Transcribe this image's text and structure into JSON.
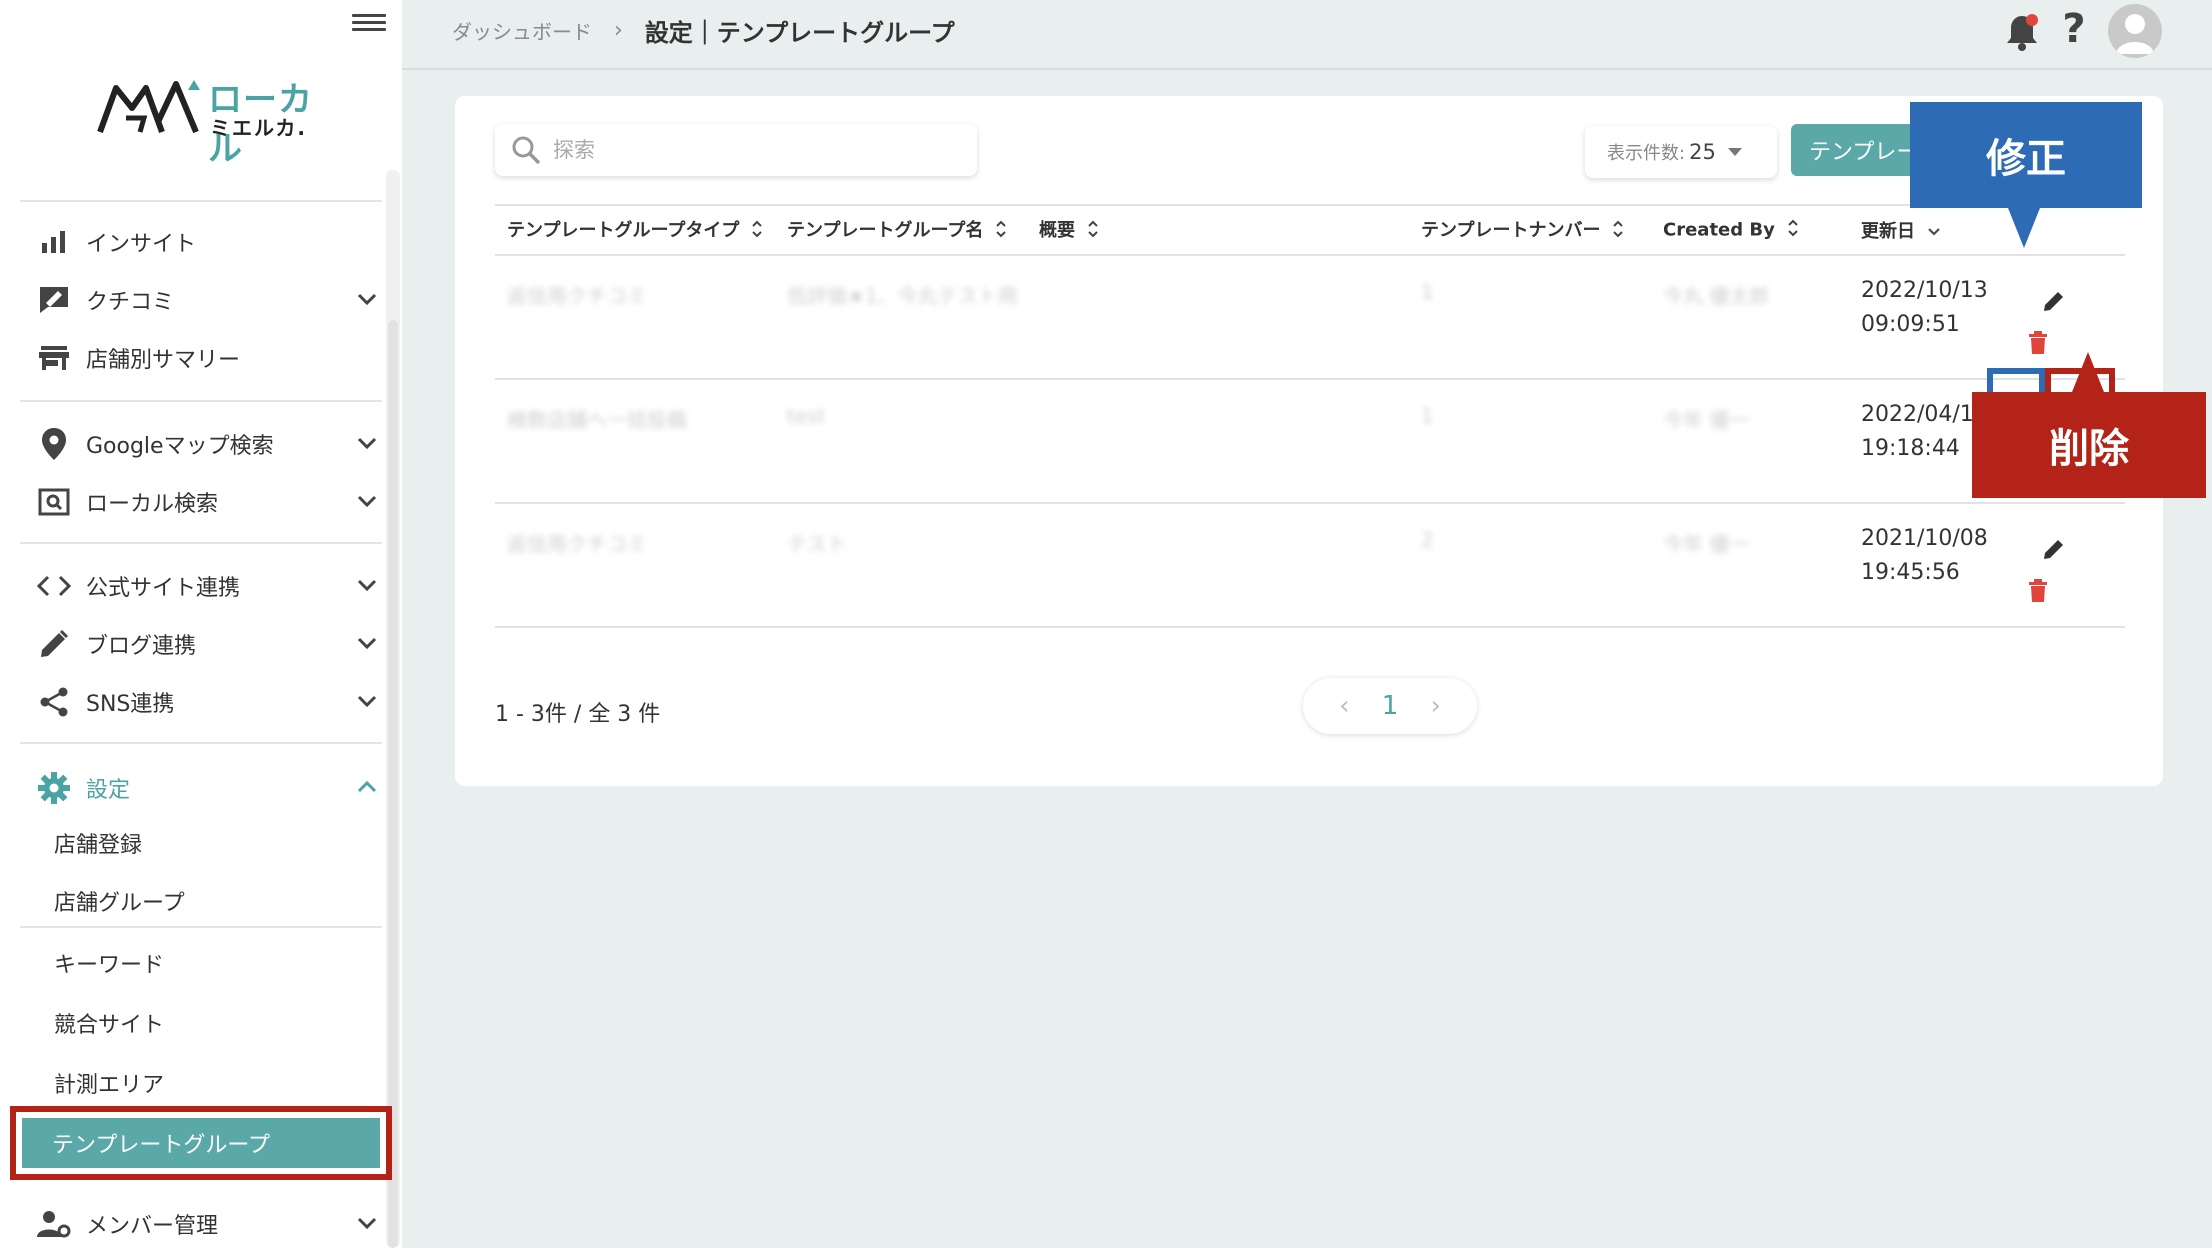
{
  "sidebar": {
    "logo": {
      "brand": "ローカル",
      "brand_sub": "ミエルカ."
    },
    "items": [
      {
        "label": "インサイト"
      },
      {
        "label": "クチコミ"
      },
      {
        "label": "店舗別サマリー"
      },
      {
        "label": "Googleマップ検索"
      },
      {
        "label": "ローカル検索"
      },
      {
        "label": "公式サイト連携"
      },
      {
        "label": "ブログ連携"
      },
      {
        "label": "SNS連携"
      },
      {
        "label": "設定"
      },
      {
        "label": "メンバー管理"
      }
    ],
    "settings_sub": [
      {
        "label": "店舗登録"
      },
      {
        "label": "店舗グループ"
      },
      {
        "label": "キーワード"
      },
      {
        "label": "競合サイト"
      },
      {
        "label": "計測エリア"
      },
      {
        "label": "テンプレートグループ"
      }
    ],
    "accent_color": "#5aa9a8"
  },
  "header": {
    "breadcrumb": {
      "root": "ダッシュボード",
      "current": "設定｜テンプレートグループ"
    },
    "help_label": "?"
  },
  "toolbar": {
    "search_placeholder": "探索",
    "per_page_label": "表示件数:",
    "per_page_value": "25",
    "add_button_label": "テンプレー"
  },
  "table": {
    "columns": [
      "テンプレートグループタイプ",
      "テンプレートグループ名",
      "概要",
      "テンプレートナンバー",
      "Created By",
      "更新日"
    ],
    "rows": [
      {
        "type": "返信用クチコミ",
        "name": "低評価★1、今丸テスト用",
        "summary": "",
        "number": "1",
        "created_by": "今丸 優太郎",
        "updated_date": "2022/10/13",
        "updated_time": "09:09:51"
      },
      {
        "type": "検数店舗へ一括投稿",
        "name": "test",
        "summary": "",
        "number": "1",
        "created_by": "今年 優一",
        "updated_date": "2022/04/15",
        "updated_time": "19:18:44"
      },
      {
        "type": "返信用クチコミ",
        "name": "テスト",
        "summary": "",
        "number": "2",
        "created_by": "今年 優一",
        "updated_date": "2021/10/08",
        "updated_time": "19:45:56"
      }
    ]
  },
  "pagination": {
    "info": "1 - 3件 / 全 3 件",
    "current": "1",
    "prev": "‹",
    "next": "›"
  },
  "callouts": {
    "edit": "修正",
    "delete": "削除"
  },
  "colors": {
    "edit_highlight": "#2e6bb5",
    "delete_highlight": "#b42318",
    "delete_icon": "#e0443a"
  }
}
